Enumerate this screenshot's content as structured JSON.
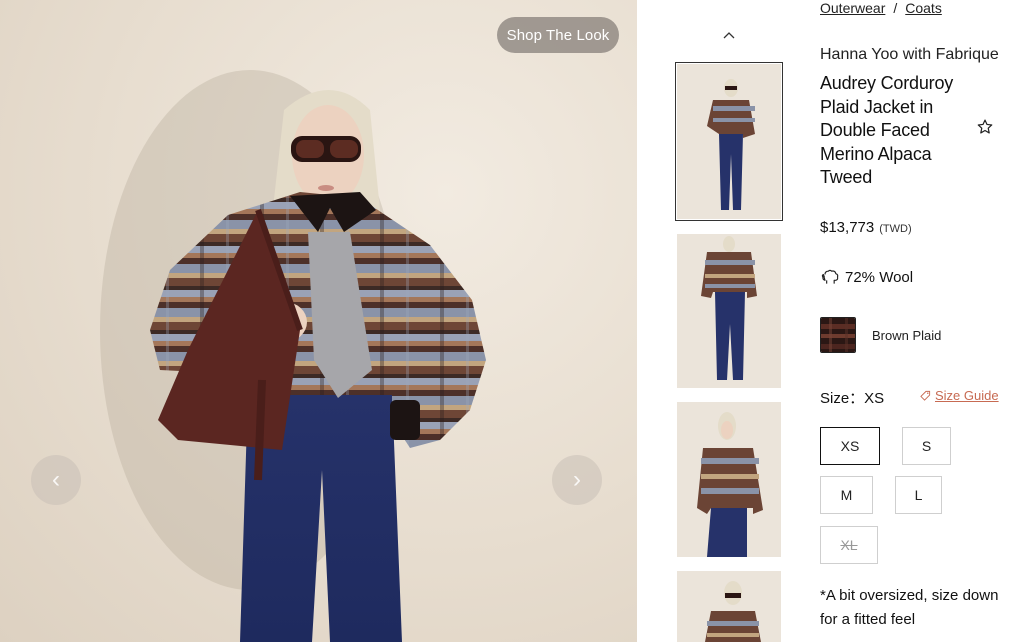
{
  "main_image": {
    "shop_the_look_label": "Shop The Look",
    "prev_arrow": "‹",
    "next_arrow": "›"
  },
  "thumbnails": {
    "up_icon": "chevron-up-icon",
    "selected_index": 0,
    "count_visible": 4
  },
  "product": {
    "breadcrumb": [
      "Outerwear",
      "Coats"
    ],
    "breadcrumb_separator": "/",
    "brand": "Hanna Yoo with Fabrique",
    "title": "Audrey Corduroy Plaid Jacket in Double Faced Merino Alpaca Tweed",
    "price": "$13,773",
    "currency": "(TWD)",
    "material": "72% Wool",
    "material_icon": "sheep-icon",
    "color_name": "Brown Plaid",
    "size_label": "Size：XS",
    "size_guide_label": "Size Guide",
    "sizes": [
      {
        "label": "XS",
        "state": "selected"
      },
      {
        "label": "S",
        "state": "available"
      },
      {
        "label": "M",
        "state": "available"
      },
      {
        "label": "L",
        "state": "available"
      },
      {
        "label": "XL",
        "state": "unavailable"
      }
    ],
    "fit_note": "*A bit oversized, size down for a fitted feel"
  },
  "colors": {
    "accent": "#c76a52",
    "selected_border": "#111111"
  }
}
